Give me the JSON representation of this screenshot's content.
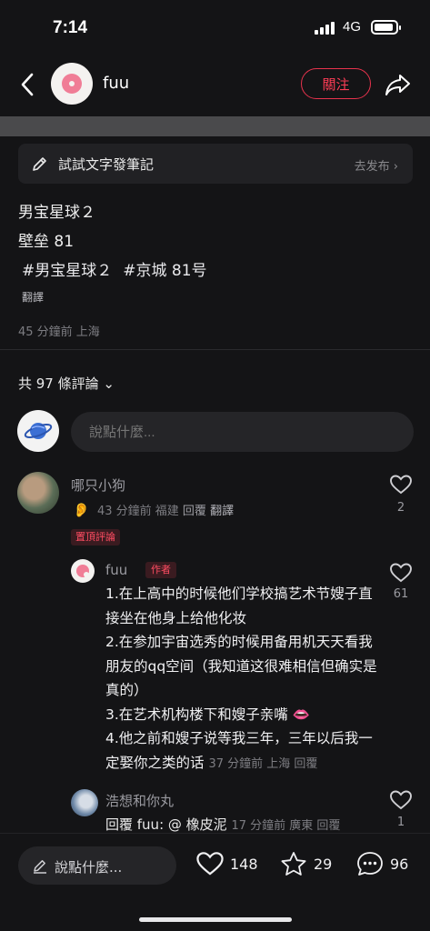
{
  "status": {
    "time": "7:14",
    "network": "4G"
  },
  "header": {
    "author": "fuu",
    "follow_label": "關注"
  },
  "draft": {
    "label": "試試文字發筆記",
    "action": "去发布 ›"
  },
  "post": {
    "line1": "男宝星球２",
    "line2": "壁垒 81",
    "tags": [
      "#男宝星球２",
      "#京城 81号"
    ],
    "translate": "翻譯",
    "meta": "45 分鐘前 上海"
  },
  "comments_header": {
    "count_label": "共 97 條評論 ⌄"
  },
  "comment_input": {
    "placeholder": "說點什麼..."
  },
  "comments": [
    {
      "name": "哪只小狗",
      "time_loc": "43 分鐘前 福建",
      "reply": "回覆",
      "translate": "翻譯",
      "likes": "2",
      "pin": "置頂評論",
      "emoji": "👂"
    }
  ],
  "reply1": {
    "name": "fuu",
    "tag": "作者",
    "likes": "61",
    "lines": [
      "1.在上高中的时候他们学校搞艺术节嫂子直接坐在他身上给他化妆",
      "2.在参加宇宙选秀的时候用备用机天天看我朋友的qq空间（我知道这很难相信但确实是真的）",
      "3.在艺术机构楼下和嫂子亲嘴 👄",
      "4.他之前和嫂子说等我三年，三年以后我一定娶你之类的话"
    ],
    "tail": "37 分鐘前 上海 回覆"
  },
  "reply2": {
    "name": "浩想和你丸",
    "text": "回覆 fuu: @ 橡皮泥",
    "meta": "17 分鐘前 廣東 回覆",
    "likes": "1"
  },
  "bottom": {
    "placeholder": "說點什麼...",
    "likes": "148",
    "stars": "29",
    "comments": "96"
  }
}
